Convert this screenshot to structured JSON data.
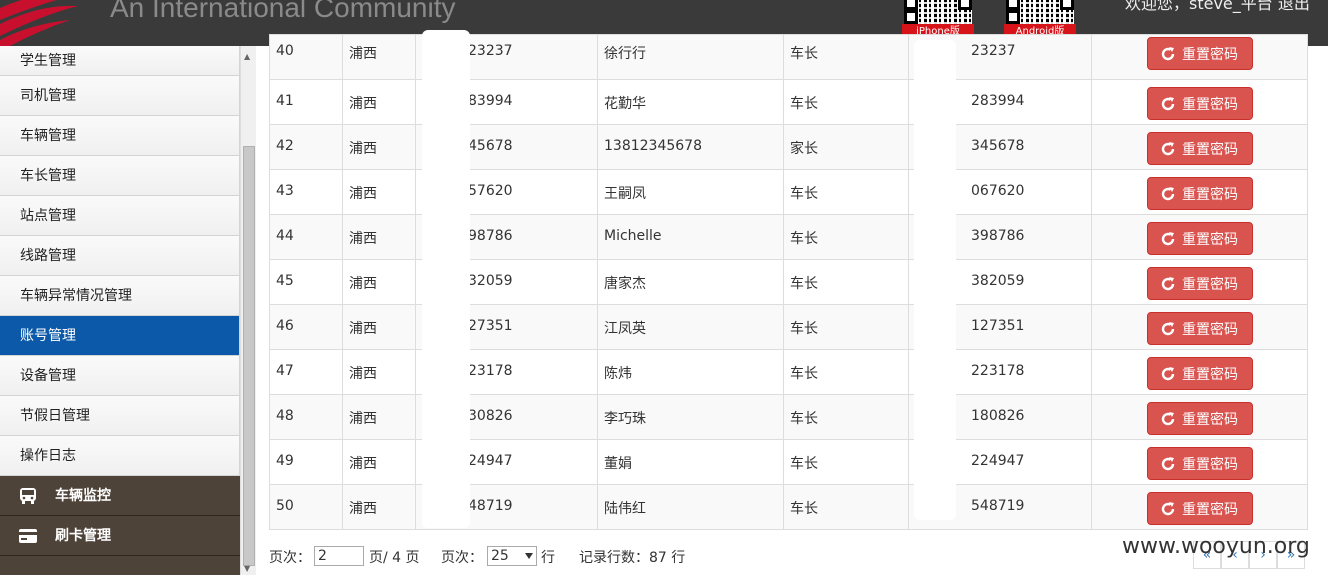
{
  "header": {
    "site_title": "An International Community",
    "qr_iphone_label": "iPhone版",
    "qr_android_label": "Android版",
    "user_text": "欢迎您，steve_平台 退出"
  },
  "sidebar": {
    "items": [
      {
        "label": "学生管理"
      },
      {
        "label": "司机管理"
      },
      {
        "label": "车辆管理"
      },
      {
        "label": "车长管理"
      },
      {
        "label": "站点管理"
      },
      {
        "label": "线路管理"
      },
      {
        "label": "车辆异常情况管理"
      },
      {
        "label": "账号管理",
        "active": true
      },
      {
        "label": "设备管理"
      },
      {
        "label": "节假日管理"
      },
      {
        "label": "操作日志"
      }
    ],
    "groups": [
      {
        "label": "车辆监控",
        "icon": "bus-icon"
      },
      {
        "label": "刷卡管理",
        "icon": "card-icon"
      }
    ]
  },
  "table": {
    "reset_label": "重置密码",
    "rows": [
      {
        "id": "40",
        "area": "浦西",
        "account": "23237",
        "name": "徐行行",
        "role": "车长",
        "phone": "23237"
      },
      {
        "id": "41",
        "area": "浦西",
        "account": "83994",
        "name": "花勤华",
        "role": "车长",
        "phone": "283994"
      },
      {
        "id": "42",
        "area": "浦西",
        "account": "45678",
        "name": "13812345678",
        "role": "家长",
        "phone": "345678"
      },
      {
        "id": "43",
        "area": "浦西",
        "account": "57620",
        "name": "王嗣凤",
        "role": "车长",
        "phone": "067620"
      },
      {
        "id": "44",
        "area": "浦西",
        "account": "98786",
        "name": "Michelle",
        "role": "车长",
        "phone": "398786"
      },
      {
        "id": "45",
        "area": "浦西",
        "account": "32059",
        "name": "唐家杰",
        "role": "车长",
        "phone": "382059"
      },
      {
        "id": "46",
        "area": "浦西",
        "account": "27351",
        "name": "江凤英",
        "role": "车长",
        "phone": "127351"
      },
      {
        "id": "47",
        "area": "浦西",
        "account": "23178",
        "name": "陈炜",
        "role": "车长",
        "phone": "223178"
      },
      {
        "id": "48",
        "area": "浦西",
        "account": "30826",
        "name": "李巧珠",
        "role": "车长",
        "phone": "180826"
      },
      {
        "id": "49",
        "area": "浦西",
        "account": "24947",
        "name": "董娟",
        "role": "车长",
        "phone": "224947"
      },
      {
        "id": "50",
        "area": "浦西",
        "account": "48719",
        "name": "陆伟红",
        "role": "车长",
        "phone": "548719"
      }
    ]
  },
  "pager": {
    "page_label": "页次：",
    "page_value": "2",
    "page_total": "页/ 4 页",
    "size_label": "页次：",
    "size_value": "25",
    "size_unit": "行",
    "records_label": "记录行数：87 行",
    "first": "«",
    "prev": "‹",
    "next": "›",
    "last": "»"
  },
  "watermark": "www.wooyun.org",
  "colors": {
    "header_bg": "#3a3a3a",
    "active_nav": "#0b59a8",
    "reset_button": "#d9534f",
    "group_bg": "#4e4339"
  }
}
